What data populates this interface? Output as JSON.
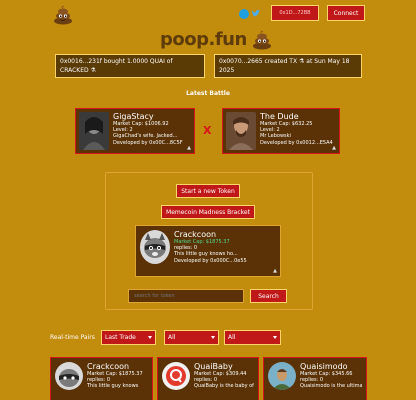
{
  "header": {
    "wallet_label": "0x1D...72BB",
    "connect_label": "Connect"
  },
  "brand": {
    "name": "poop.fun"
  },
  "tickers": [
    {
      "text": "0x0016...231f bought 1.0000 QUAI of CRACKED ⚗"
    },
    {
      "text": "0x0070...2665 created TX ⚗ at Sun May 18 2025"
    }
  ],
  "battle": {
    "title": "Latest Battle",
    "vs": "X",
    "left": {
      "name": "GigaStacy",
      "market_cap": "Market Cap: $1006.92",
      "level": "Level: 2",
      "desc": "GigaChad's wife. Jacked...",
      "dev": "Developed by 0x00C...8C5F"
    },
    "right": {
      "name": "The Dude",
      "market_cap": "Market Cap: $632.25",
      "level": "Level: 2",
      "desc": "Mr Lebowski",
      "dev": "Developed by 0x0012...E5A4"
    }
  },
  "actions": {
    "start_token": "Start a new Token",
    "bracket": "Memecoin Madness Bracket"
  },
  "featured": {
    "name": "Crackcoon",
    "market_cap": "Market Cap: $1875.37",
    "replies": "replies: 0",
    "desc": "This little guy knows ho...",
    "dev": "Developed by 0x000C...0e55"
  },
  "search": {
    "placeholder": "search for token",
    "button": "Search"
  },
  "filters": {
    "label": "Real-time Pairs",
    "sort": "Last Trade",
    "filter_a": "All",
    "filter_b": "All"
  },
  "token_list": [
    {
      "name": "Crackcoon",
      "market_cap": "Market Cap: $1875.37",
      "replies": "replies: 0",
      "desc": "This little guy knows"
    },
    {
      "name": "QuaiBaby",
      "market_cap": "Market Cap: $309.44",
      "replies": "replies: 0",
      "desc": "QuaiBaby is the baby of..."
    },
    {
      "name": "Quaisimodo",
      "market_cap": "Market Cap: $345.66",
      "replies": "replies: 0",
      "desc": "Quaisimodo is the ultima..."
    }
  ],
  "colors": {
    "background": "#c28c0c",
    "card": "#5a3206",
    "accent_red": "#c01818",
    "border_gold": "#ffd56a",
    "market_cap_green": "#50d890"
  }
}
